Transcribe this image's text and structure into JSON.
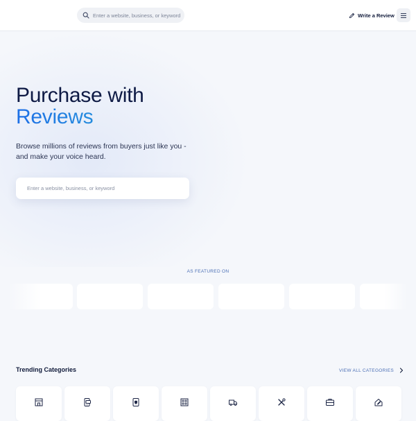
{
  "header": {
    "search_placeholder": "Enter a website, business, or keyword",
    "search_icon": "search-icon",
    "write_review_label": "Write a Review",
    "write_review_icon": "pencil-icon",
    "menu_icon": "hamburger-menu-icon"
  },
  "hero": {
    "title_line1": "Purchase with",
    "title_line2": "Reviews",
    "subtitle": "Browse millions of reviews from buyers just like you - and make your voice heard.",
    "search_placeholder": "Enter a website, business, or keyword"
  },
  "featured": {
    "label": "AS FEATURED ON",
    "logo_count": 6
  },
  "trending": {
    "title": "Trending Categories",
    "view_all_label": "VIEW ALL CATEGORIES",
    "view_all_icon": "chevron-right-icon",
    "categories": [
      {
        "icon": "storefront-icon"
      },
      {
        "icon": "phone-money-icon"
      },
      {
        "icon": "shield-icon"
      },
      {
        "icon": "building-icon"
      },
      {
        "icon": "truck-icon"
      },
      {
        "icon": "tools-icon"
      },
      {
        "icon": "briefcase-icon"
      },
      {
        "icon": "home-edit-icon"
      }
    ]
  },
  "colors": {
    "background": "#f5f7fb",
    "title": "#0e1a45",
    "accent_start": "#1d6fe6",
    "accent_end": "#2a9fd8",
    "link": "#4b6fb5"
  }
}
